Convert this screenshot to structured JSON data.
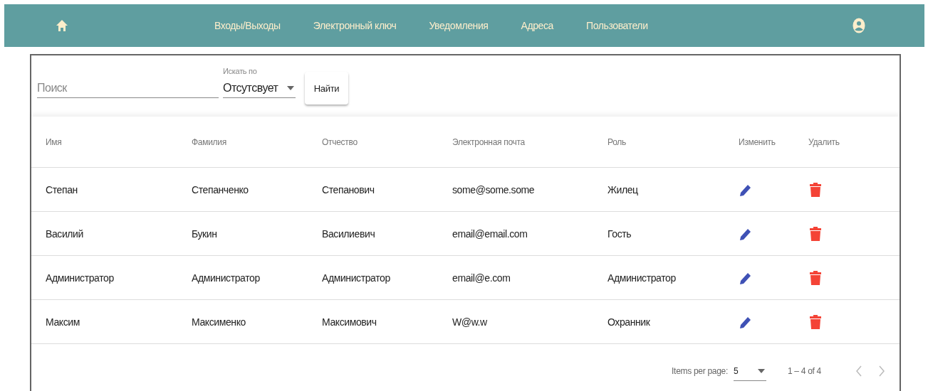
{
  "nav": {
    "items": [
      {
        "label": "Входы/Выходы"
      },
      {
        "label": "Электронный ключ"
      },
      {
        "label": "Уведомления"
      },
      {
        "label": "Адреса"
      },
      {
        "label": "Пользователи"
      }
    ]
  },
  "search": {
    "placeholder": "Поиск",
    "select_label": "Искать по",
    "select_value": "Отсутсвует",
    "button": "Найти"
  },
  "table": {
    "columns": [
      "Имя",
      "Фамилия",
      "Отчество",
      "Электронная почта",
      "Роль",
      "Изменить",
      "Удалить"
    ],
    "rows": [
      [
        "Степан",
        "Степанченко",
        "Степанович",
        "some@some.some",
        "Жилец"
      ],
      [
        "Василий",
        "Букин",
        "Василиевич",
        "email@email.com",
        "Гость"
      ],
      [
        "Администратор",
        "Администратор",
        "Администратор",
        "email@e.com",
        "Администратор"
      ],
      [
        "Максим",
        "Максименко",
        "Максимович",
        "W@w.w",
        "Охранник"
      ]
    ]
  },
  "paginator": {
    "label": "Items per page:",
    "page_size": "5",
    "range": "1 – 4 of 4"
  }
}
